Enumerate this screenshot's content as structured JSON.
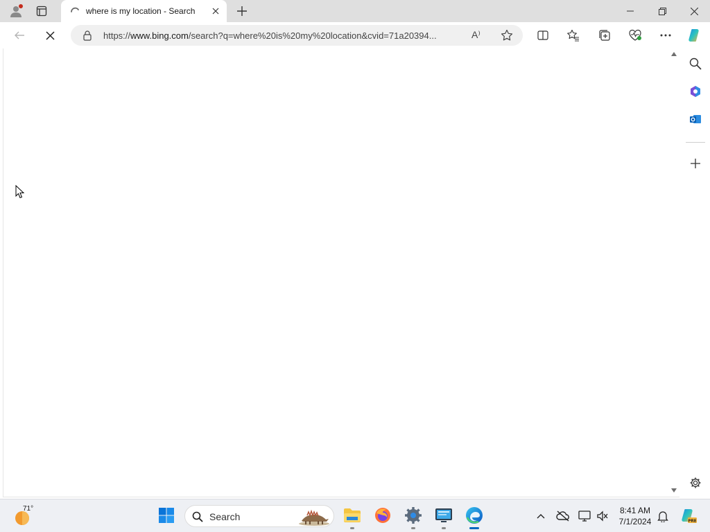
{
  "browser": {
    "tab": {
      "title": "where is my location - Search"
    },
    "address_bar": {
      "url_prefix": "https://",
      "url_host": "www.bing.com",
      "url_rest": "/search?q=where%20is%20my%20location&cvid=71a20394...",
      "read_aloud_glyph": "A⁾"
    },
    "status": "loading"
  },
  "icons": {
    "profile": "profile-icon",
    "tab_actions": "tab-actions-icon",
    "loading": "loading-spinner-icon",
    "close_tab": "close-icon",
    "new_tab": "plus-icon",
    "minimize": "minimize-icon",
    "restore": "restore-icon",
    "close_window": "close-icon",
    "back": "back-arrow-icon",
    "stop": "stop-icon",
    "lock": "lock-icon",
    "favorite": "star-icon",
    "split_screen": "split-screen-icon",
    "favorites": "favorites-icon",
    "collections": "collections-icon",
    "browser_essentials": "heart-pulse-icon",
    "more": "more-icon",
    "copilot": "copilot-icon",
    "sidebar_search": "search-icon",
    "sidebar_office": "office-icon",
    "sidebar_outlook": "outlook-icon",
    "sidebar_add": "plus-icon",
    "sidebar_settings": "gear-icon"
  },
  "taskbar": {
    "weather": {
      "temp": "71°"
    },
    "search_label": "Search",
    "apps": [
      "start",
      "file-explorer",
      "firefox",
      "settings",
      "remote-desktop",
      "edge"
    ],
    "clock": {
      "time": "8:41 AM",
      "date": "7/1/2024"
    }
  },
  "colors": {
    "accent": "#0067c0",
    "tabstrip": "#dfdfdf",
    "taskbar": "#eef0f4",
    "profile_badge": "#c42b1c"
  }
}
